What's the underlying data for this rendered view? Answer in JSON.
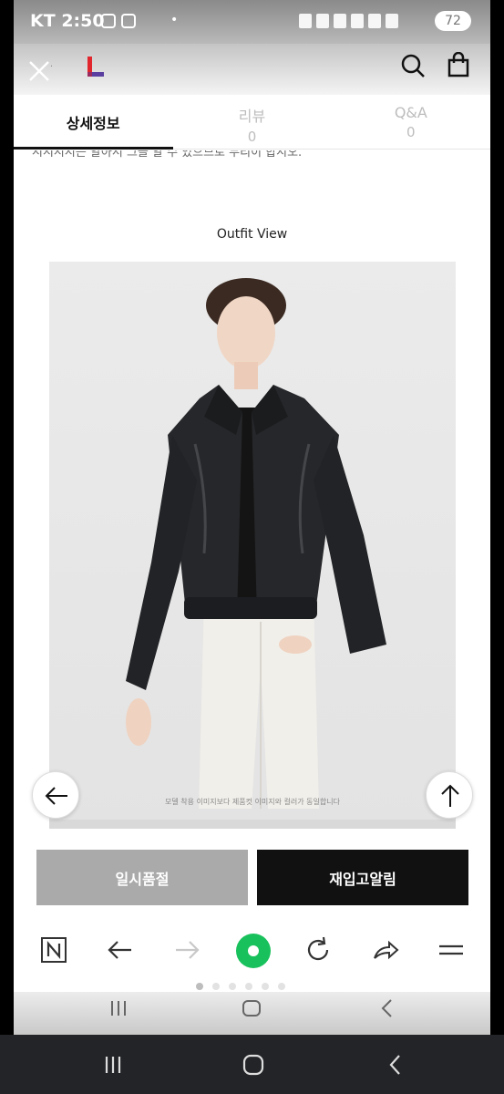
{
  "status_bar": {
    "carrier": "KT",
    "time": "2:50",
    "battery": "72"
  },
  "header": {
    "close_icon": "close-icon",
    "logo_icon": "lotte-logo-icon",
    "search_icon": "search-icon",
    "bag_icon": "shopping-bag-icon"
  },
  "tabs": [
    {
      "label": "상세정보",
      "count": ""
    },
    {
      "label": "리뷰",
      "count": "0"
    },
    {
      "label": "Q&A",
      "count": "0"
    }
  ],
  "content": {
    "cut_off_text": "시시시시는 알아서 그을 알 수 있으므로 무리이 합시오.",
    "section_title": "Outfit View",
    "photo_caption": "모델 착용 이미지보다 제품컷 이미지와 컬러가 동일합니다"
  },
  "actions": {
    "soldout_label": "일시품절",
    "restock_label": "재입고알림"
  },
  "colors": {
    "accent_green": "#19c15c",
    "dark_button": "#111111",
    "gray_button": "#aaaaaa"
  }
}
